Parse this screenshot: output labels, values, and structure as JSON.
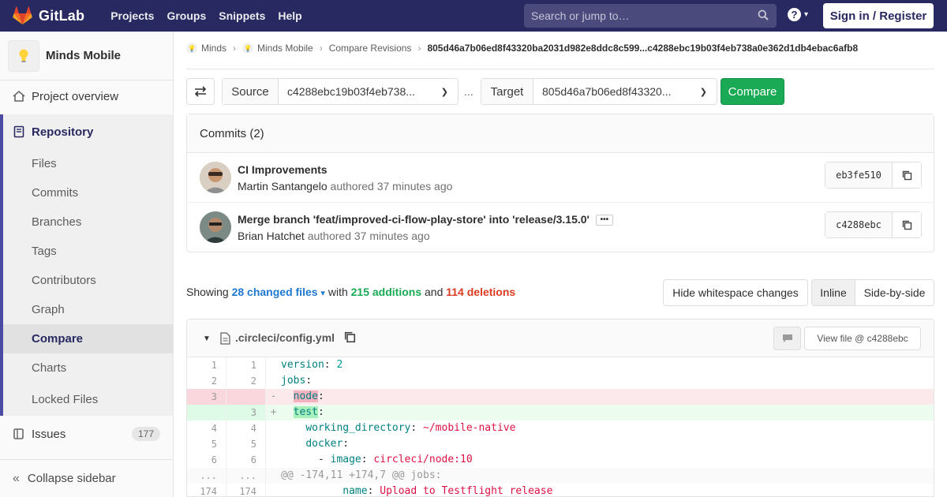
{
  "nav": {
    "brand": "GitLab",
    "links": [
      "Projects",
      "Groups",
      "Snippets",
      "Help"
    ],
    "search_placeholder": "Search or jump to…",
    "signin": "Sign in / Register"
  },
  "sidebar": {
    "project_name": "Minds Mobile",
    "overview": "Project overview",
    "repository": "Repository",
    "repo_items": [
      "Files",
      "Commits",
      "Branches",
      "Tags",
      "Contributors",
      "Graph",
      "Compare",
      "Charts",
      "Locked Files"
    ],
    "issues": "Issues",
    "issues_count": "177",
    "collapse": "Collapse sidebar"
  },
  "breadcrumb": {
    "items": [
      "Minds",
      "Minds Mobile",
      "Compare Revisions"
    ],
    "current": "805d46a7b06ed8f43320ba2031d982e8ddc8c599...c4288ebc19b03f4eb738a0e362d1db4ebac6afb8"
  },
  "compare": {
    "source_label": "Source",
    "source_value": "c4288ebc19b03f4eb738...",
    "separator": "...",
    "target_label": "Target",
    "target_value": "805d46a7b06ed8f43320...",
    "button": "Compare"
  },
  "commits": {
    "header": "Commits (2)",
    "items": [
      {
        "title": "CI Improvements",
        "author": "Martin Santangelo",
        "meta": "authored 37 minutes ago",
        "sha": "eb3fe510"
      },
      {
        "title": "Merge branch 'feat/improved-ci-flow-play-store' into 'release/3.15.0'",
        "author": "Brian Hatchet",
        "meta": "authored 37 minutes ago",
        "sha": "c4288ebc"
      }
    ]
  },
  "stats": {
    "showing": "Showing",
    "changed": "28 changed files",
    "with": "with",
    "additions": "215 additions",
    "and": "and",
    "deletions": "114 deletions",
    "hide_ws": "Hide whitespace changes",
    "inline": "Inline",
    "side_by_side": "Side-by-side"
  },
  "file": {
    "name": ".circleci/config.yml",
    "view_file": "View file @ c4288ebc",
    "lines": [
      {
        "old": "1",
        "new": "1",
        "type": "ctx",
        "key": "version",
        "sep": ": ",
        "val": "2",
        "valtype": "num",
        "indent": ""
      },
      {
        "old": "2",
        "new": "2",
        "type": "ctx",
        "key": "jobs",
        "sep": ":",
        "val": "",
        "valtype": "",
        "indent": ""
      },
      {
        "old": "3",
        "new": "",
        "type": "old",
        "key": "node",
        "sep": ":",
        "val": "",
        "valtype": "",
        "indent": "  "
      },
      {
        "old": "",
        "new": "3",
        "type": "new",
        "key": "test",
        "sep": ":",
        "val": "",
        "valtype": "",
        "indent": "  "
      },
      {
        "old": "4",
        "new": "4",
        "type": "ctx",
        "key": "working_directory",
        "sep": ": ",
        "val": "~/mobile-native",
        "valtype": "str",
        "indent": "    "
      },
      {
        "old": "5",
        "new": "5",
        "type": "ctx",
        "key": "docker",
        "sep": ":",
        "val": "",
        "valtype": "",
        "indent": "    "
      },
      {
        "old": "6",
        "new": "6",
        "type": "ctx",
        "key": "image",
        "sep": ": ",
        "val": "circleci/node:10",
        "valtype": "str",
        "indent": "      - "
      },
      {
        "old": "...",
        "new": "...",
        "type": "match",
        "text": "@@ -174,11 +174,7 @@ jobs:"
      },
      {
        "old": "174",
        "new": "174",
        "type": "ctx",
        "key": "name",
        "sep": ": ",
        "val": "Upload to Testflight release",
        "valtype": "str",
        "indent": "          "
      }
    ]
  },
  "colors": {
    "nav_bg": "#292961",
    "compare_btn": "#1aaa55",
    "link": "#1f78d1",
    "deletions": "#db3b21"
  }
}
